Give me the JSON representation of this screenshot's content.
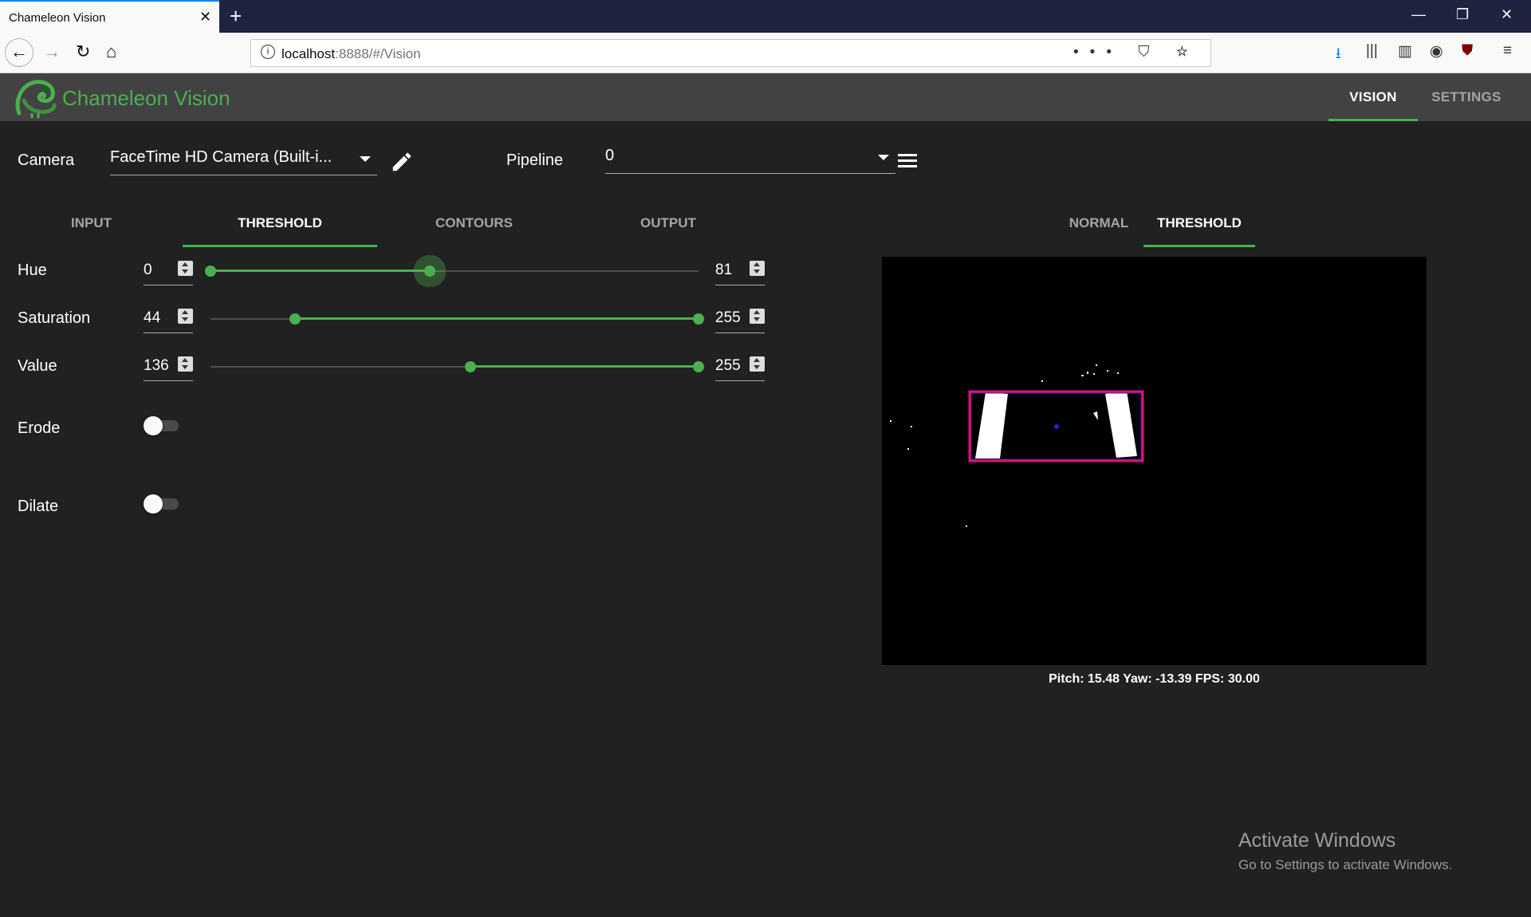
{
  "browser": {
    "tab_title": "Chameleon Vision",
    "tab_close": "✕",
    "new_tab": "+",
    "url_host": "localhost",
    "url_rest": ":8888/#/Vision",
    "url_icons": "••• ⛉ ☆",
    "win_min": "—",
    "win_restore": "❐",
    "win_close": "✕"
  },
  "app": {
    "title": "Chameleon Vision",
    "brand_color": "#4caf50",
    "nav": {
      "vision": "VISION",
      "settings": "SETTINGS"
    },
    "active_nav": "VISION"
  },
  "camera": {
    "label": "Camera",
    "value": "FaceTime HD Camera (Built-i..."
  },
  "pipeline": {
    "label": "Pipeline",
    "value": "0"
  },
  "pipeline_tabs": [
    "INPUT",
    "THRESHOLD",
    "CONTOURS",
    "OUTPUT"
  ],
  "active_pipeline_tab": "THRESHOLD",
  "threshold": {
    "hue": {
      "label": "Hue",
      "min": "0",
      "max": "81",
      "range": 180
    },
    "saturation": {
      "label": "Saturation",
      "min": "44",
      "max": "255",
      "range": 255
    },
    "value": {
      "label": "Value",
      "min": "136",
      "max": "255",
      "range": 255
    },
    "erode": {
      "label": "Erode",
      "on": false
    },
    "dilate": {
      "label": "Dilate",
      "on": false
    }
  },
  "view_tabs": [
    "NORMAL",
    "THRESHOLD"
  ],
  "active_view_tab": "THRESHOLD",
  "stats": "Pitch: 15.48 Yaw: -13.39 FPS: 30.00",
  "watermark": {
    "title": "Activate Windows",
    "subtitle": "Go to Settings to activate Windows."
  }
}
